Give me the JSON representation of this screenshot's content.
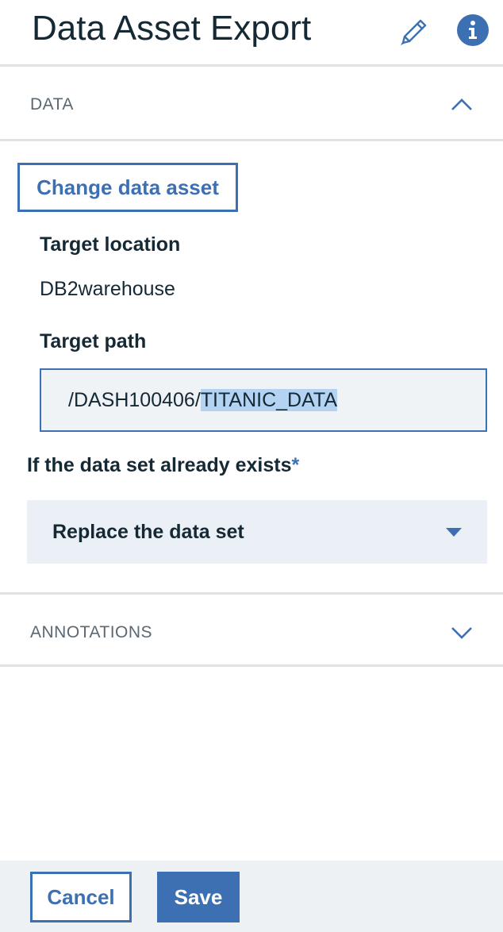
{
  "header": {
    "title": "Data Asset Export",
    "edit_icon": "pencil-icon",
    "info_icon": "info-icon"
  },
  "data_section": {
    "label": "DATA",
    "expanded": true,
    "toggle_icon": "chevron-up-icon"
  },
  "change_asset": {
    "label": "Change data asset"
  },
  "target_location": {
    "label": "Target location",
    "value": "DB2warehouse"
  },
  "target_path": {
    "label": "Target path",
    "prefix": "/DASH100406/",
    "selected": "TITANIC_DATA"
  },
  "if_exists": {
    "label": "If the data set already exists",
    "required_marker": "*",
    "selected_option": "Replace the data set",
    "caret_icon": "caret-down-icon"
  },
  "annotations_section": {
    "label": "ANNOTATIONS",
    "expanded": false,
    "toggle_icon": "chevron-down-icon"
  },
  "footer": {
    "cancel_label": "Cancel",
    "save_label": "Save"
  },
  "colors": {
    "accent": "#3d70b2",
    "text": "#152935",
    "muted": "#5a6872",
    "divider": "#dfe3e6",
    "select_bg": "#ebf0f7",
    "selection": "#b4d2f2"
  }
}
